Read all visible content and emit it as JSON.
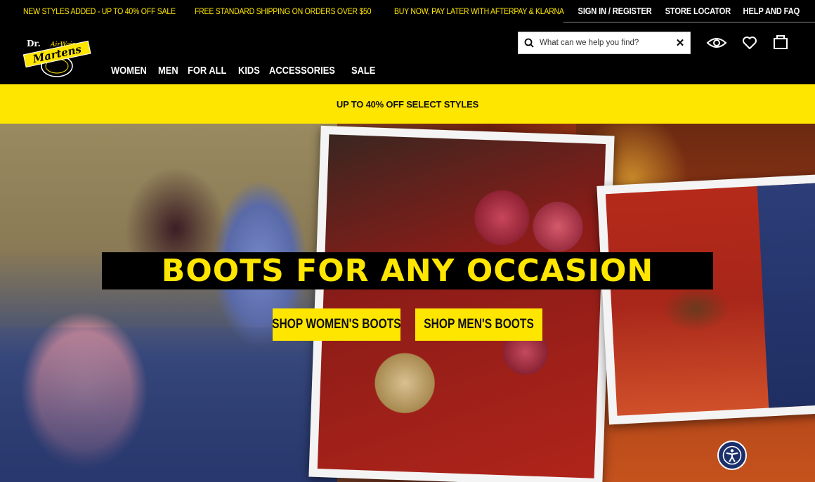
{
  "promo": {
    "messages": [
      "NEW STYLES ADDED - UP TO 40% OFF SALE",
      "FREE STANDARD SHIPPING ON ORDERS OVER $50",
      "BUY NOW, PAY LATER WITH AFTERPAY & KLARNA"
    ],
    "links": [
      "SIGN IN / REGISTER",
      "STORE LOCATOR",
      "HELP AND FAQ"
    ]
  },
  "header": {
    "logo_text": "Dr. Martens",
    "nav": [
      "WOMEN",
      "MEN",
      "FOR ALL",
      "KIDS",
      "ACCESSORIES",
      "SALE"
    ],
    "search": {
      "placeholder": "What can we help you find?",
      "clear_icon": "close-icon"
    },
    "icons": [
      "eye-icon",
      "heart-icon",
      "bag-icon"
    ]
  },
  "sale_banner": {
    "text": "UP TO 40% OFF SELECT STYLES"
  },
  "hero": {
    "title": "BOOTS FOR ANY OCCASION",
    "cta_women": "SHOP WOMEN'S BOOTS",
    "cta_men": "SHOP MEN'S BOOTS"
  },
  "accessibility": {
    "icon": "accessibility-icon"
  },
  "colors": {
    "brand_yellow": "#ffe600",
    "black": "#000000",
    "white": "#ffffff",
    "a11y_blue": "#1b2f6b"
  }
}
